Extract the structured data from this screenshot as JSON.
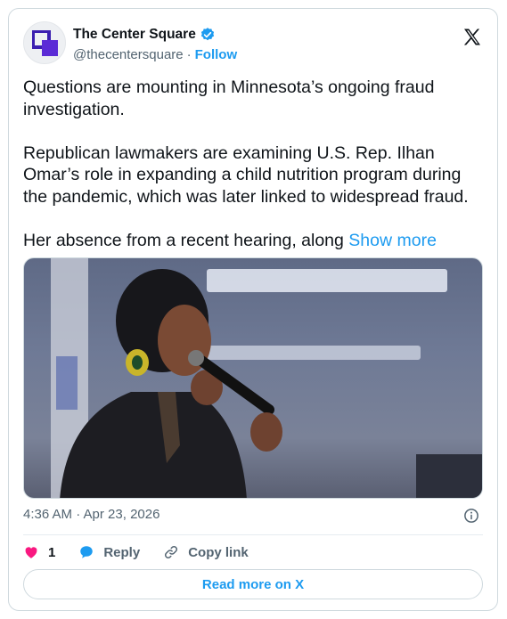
{
  "author": {
    "display_name": "The Center Square",
    "handle": "@thecentersquare",
    "separator": "·",
    "follow_label": "Follow",
    "verified": true
  },
  "tweet": {
    "paragraph_1": "Questions are mounting in Minnesota’s ongoing fraud investigation.",
    "paragraph_2": "Republican lawmakers are examining U.S. Rep. Ilhan Omar’s role in expanding a child nutrition program during the pandemic, which was later linked to widespread fraud.",
    "paragraph_3": "Her absence from a recent hearing, along",
    "show_more_label": "Show more"
  },
  "meta": {
    "timestamp": "4:36 AM · Apr 23, 2026"
  },
  "actions": {
    "like_count": "1",
    "reply_label": "Reply",
    "copy_link_label": "Copy link"
  },
  "footer": {
    "read_more_label": "Read more on X"
  },
  "colors": {
    "accent": "#1d9bf0",
    "like": "#f91880",
    "brand_logo": "#5b2bd6"
  },
  "icons": {
    "avatar": "center-square-logo",
    "verified": "verified-badge-icon",
    "platform": "x-logo-icon",
    "info": "info-icon",
    "like": "heart-icon",
    "reply": "reply-bubble-icon",
    "copy": "link-icon"
  }
}
